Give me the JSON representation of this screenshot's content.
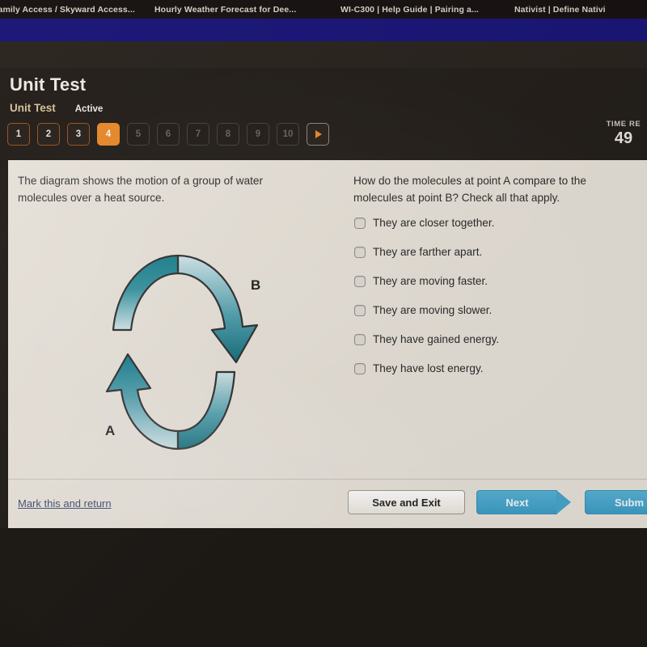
{
  "browser": {
    "tabs": [
      {
        "title": "Family Access / Skyward Access..."
      },
      {
        "title": "Hourly Weather Forecast for Dee..."
      },
      {
        "title": "WI-C300 | Help Guide | Pairing a..."
      },
      {
        "title": "Nativist | Define Nativi"
      }
    ]
  },
  "header": {
    "title": "Unit Test",
    "breadcrumb": "Unit Test",
    "status": "Active"
  },
  "pager": {
    "questions": [
      {
        "label": "1",
        "state": "done"
      },
      {
        "label": "2",
        "state": "done"
      },
      {
        "label": "3",
        "state": "done"
      },
      {
        "label": "4",
        "state": "active"
      },
      {
        "label": "5",
        "state": "locked"
      },
      {
        "label": "6",
        "state": "locked"
      },
      {
        "label": "7",
        "state": "locked"
      },
      {
        "label": "8",
        "state": "locked"
      },
      {
        "label": "9",
        "state": "locked"
      },
      {
        "label": "10",
        "state": "locked"
      }
    ],
    "next_arrow_icon": "play-triangle-icon"
  },
  "timer": {
    "label": "TIME RE",
    "value": "49"
  },
  "question": {
    "stem": "The diagram shows the motion of a group of water molecules over a heat source.",
    "prompt": "How do the molecules at point A compare to the molecules at point B? Check all that apply.",
    "choices": [
      {
        "label": "They are closer together.",
        "checked": false
      },
      {
        "label": "They are farther apart.",
        "checked": false
      },
      {
        "label": "They are moving faster.",
        "checked": false
      },
      {
        "label": "They are moving slower.",
        "checked": false
      },
      {
        "label": "They have gained energy.",
        "checked": false
      },
      {
        "label": "They have lost energy.",
        "checked": false
      }
    ]
  },
  "diagram": {
    "description": "Two curved teal gradient arrows forming a vertical convection circulation loop",
    "label_a": "A",
    "label_b": "B",
    "arrow_color_dark": "#12707f",
    "arrow_color_light": "#a9cfd6"
  },
  "footer": {
    "mark_link": "Mark this and return",
    "save_exit": "Save and Exit",
    "next": "Next",
    "submit": "Subm"
  },
  "colors": {
    "accent_orange": "#e8892b",
    "blue_button": "#47a4c9",
    "card_bg": "#e6e0d7",
    "page_dark": "#241f1b",
    "bookmark_blue": "#1a1577"
  }
}
